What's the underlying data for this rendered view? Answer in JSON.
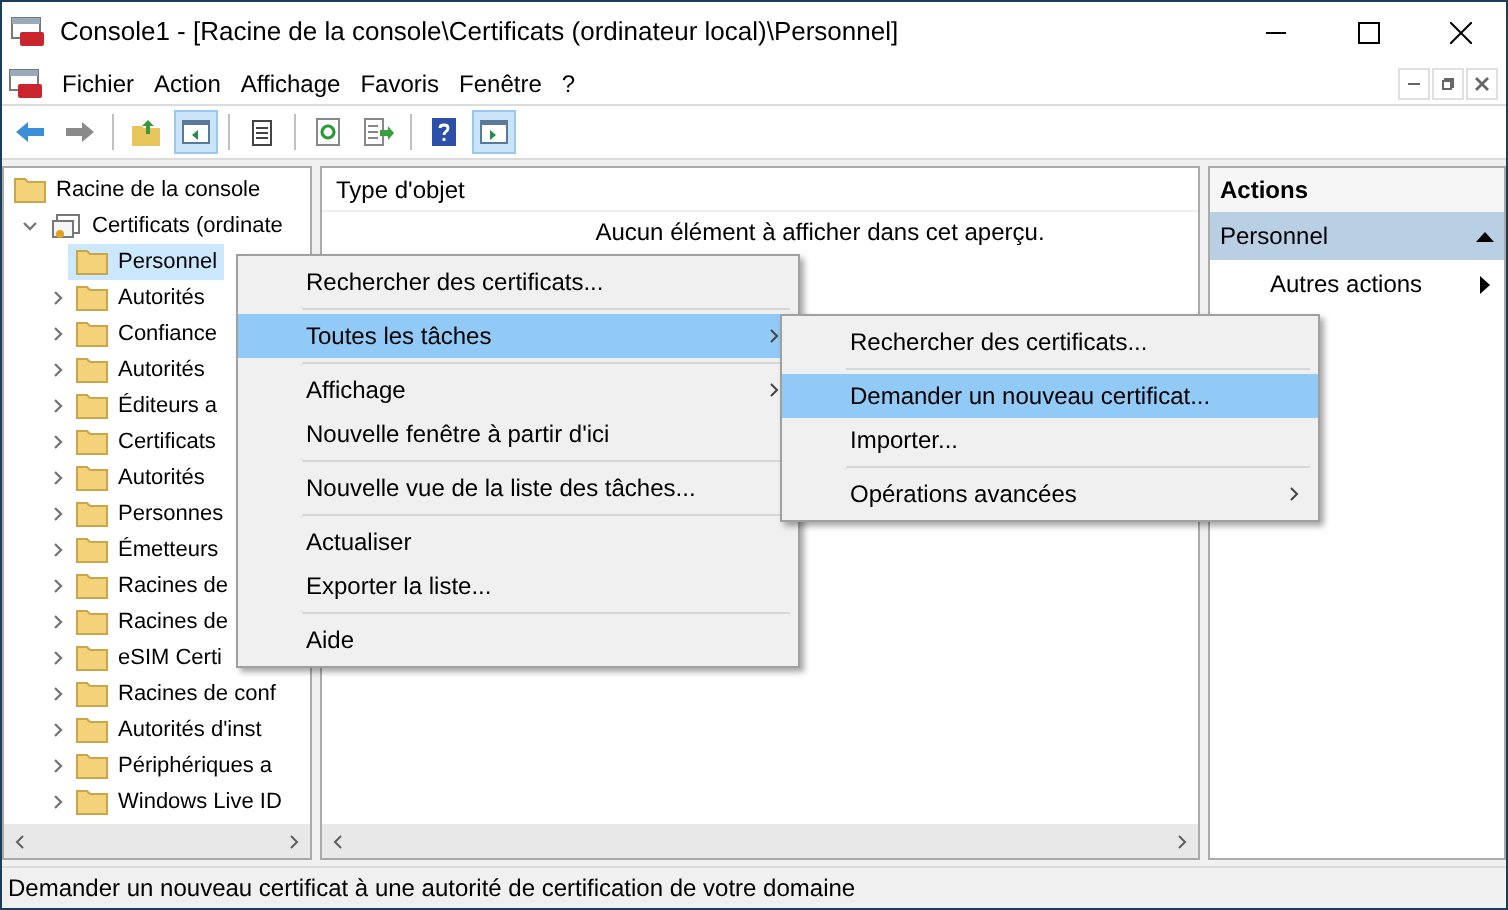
{
  "window": {
    "title": "Console1 - [Racine de la console\\Certificats (ordinateur local)\\Personnel]"
  },
  "menu_bar": [
    "Fichier",
    "Action",
    "Affichage",
    "Favoris",
    "Fenêtre",
    "?"
  ],
  "tree": {
    "label": "Racine de la console",
    "children": [
      {
        "label": "Certificats (ordinate",
        "expanded": true,
        "selected": false,
        "children": [
          {
            "label": "Personnel",
            "selected": true
          },
          {
            "label": "Autorités",
            "selected": false
          },
          {
            "label": "Confiance",
            "selected": false
          },
          {
            "label": "Autorités",
            "selected": false
          },
          {
            "label": "Éditeurs a",
            "selected": false
          },
          {
            "label": "Certificats",
            "selected": false
          },
          {
            "label": "Autorités",
            "selected": false
          },
          {
            "label": "Personnes",
            "selected": false
          },
          {
            "label": "Émetteurs",
            "selected": false
          },
          {
            "label": "Racines de",
            "selected": false
          },
          {
            "label": "Racines de",
            "selected": false
          },
          {
            "label": "eSIM Certi",
            "selected": false
          },
          {
            "label": "Racines de conf",
            "selected": false
          },
          {
            "label": "Autorités d'inst",
            "selected": false
          },
          {
            "label": "Périphériques a",
            "selected": false
          },
          {
            "label": "Windows Live ID",
            "selected": false
          }
        ]
      }
    ]
  },
  "content": {
    "column": "Type d'objet",
    "empty_message": "Aucun élément à afficher dans cet aperçu."
  },
  "actions": {
    "title": "Actions",
    "section": "Personnel",
    "items": [
      {
        "label": "Autres actions"
      }
    ]
  },
  "context_menu": [
    {
      "kind": "item",
      "label": "Rechercher des certificats...",
      "selected": false,
      "submenu": false
    },
    {
      "kind": "separator"
    },
    {
      "kind": "item",
      "label": "Toutes les tâches",
      "selected": true,
      "submenu": true
    },
    {
      "kind": "separator"
    },
    {
      "kind": "item",
      "label": "Affichage",
      "selected": false,
      "submenu": true
    },
    {
      "kind": "item",
      "label": "Nouvelle fenêtre à partir d'ici",
      "selected": false,
      "submenu": false
    },
    {
      "kind": "separator"
    },
    {
      "kind": "item",
      "label": "Nouvelle vue de la liste des tâches...",
      "selected": false,
      "submenu": false
    },
    {
      "kind": "separator"
    },
    {
      "kind": "item",
      "label": "Actualiser",
      "selected": false,
      "submenu": false
    },
    {
      "kind": "item",
      "label": "Exporter la liste...",
      "selected": false,
      "submenu": false
    },
    {
      "kind": "separator"
    },
    {
      "kind": "item",
      "label": "Aide",
      "selected": false,
      "submenu": false
    }
  ],
  "submenu": [
    {
      "kind": "item",
      "label": "Rechercher des certificats...",
      "selected": false,
      "submenu": false
    },
    {
      "kind": "separator"
    },
    {
      "kind": "item",
      "label": "Demander un nouveau certificat...",
      "selected": true,
      "submenu": false
    },
    {
      "kind": "item",
      "label": "Importer...",
      "selected": false,
      "submenu": false
    },
    {
      "kind": "separator"
    },
    {
      "kind": "item",
      "label": "Opérations avancées",
      "selected": false,
      "submenu": true
    }
  ],
  "status_bar": "Demander un nouveau certificat à une autorité de certification de votre domaine"
}
